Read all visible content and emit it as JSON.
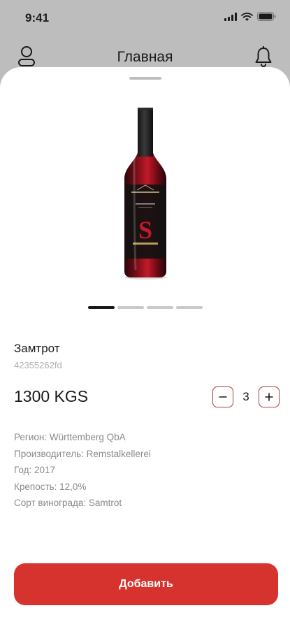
{
  "status_bar": {
    "time": "9:41"
  },
  "header": {
    "title": "Главная"
  },
  "product": {
    "name": "Замтрот",
    "sku": "42355262fd",
    "price": "1300 KGS",
    "quantity": "3",
    "label_letter": "S"
  },
  "carousel": {
    "total": 4,
    "active_index": 0
  },
  "specs": [
    {
      "text": "Регион: Württemberg QbA"
    },
    {
      "text": "Производитель: Remstalkellerei"
    },
    {
      "text": "Год: 2017"
    },
    {
      "text": "Крепость: 12,0%"
    },
    {
      "text": "Сорт винограда: Samtrot"
    }
  ],
  "actions": {
    "add_label": "Добавить"
  },
  "colors": {
    "accent": "#d7332e",
    "stepper_border": "#b03a3a",
    "backdrop": "#bdbdbd"
  },
  "icons": [
    "signal-icon",
    "wifi-icon",
    "battery-icon",
    "profile-icon",
    "bell-icon",
    "minus-icon",
    "plus-icon",
    "wine-bottle"
  ]
}
